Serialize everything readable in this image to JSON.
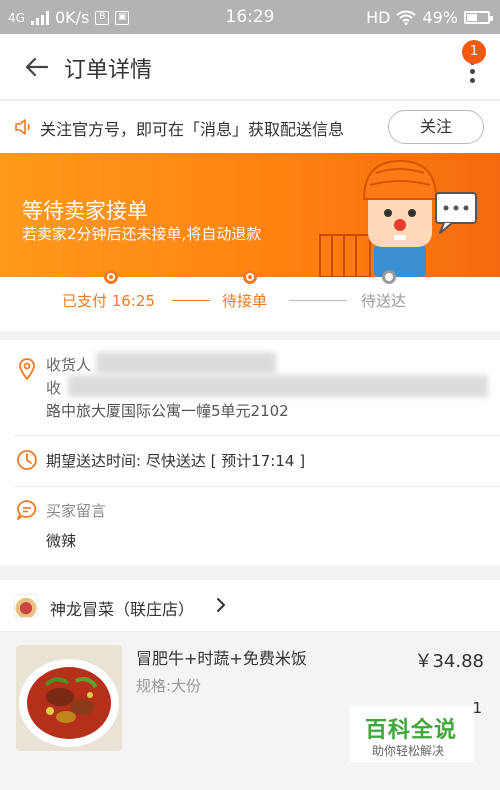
{
  "status_bar": {
    "network": "4G",
    "speed": "0K/s",
    "time": "16:29",
    "hd": "HD",
    "battery": "49%"
  },
  "nav": {
    "title": "订单详情",
    "badge": "1"
  },
  "notice": {
    "text": "关注官方号，即可在「消息」获取配送信息",
    "button": "关注"
  },
  "banner": {
    "headline": "等待卖家接单",
    "subtext": "若卖家2分钟后还未接单,将自动退款"
  },
  "progress": {
    "steps": [
      {
        "label": "已支付 16:25",
        "state": "done"
      },
      {
        "label": "待接单",
        "state": "current"
      },
      {
        "label": "待送达",
        "state": "pending"
      }
    ]
  },
  "address": {
    "line1": "收货人",
    "line2": "收",
    "line3": "路中旅大厦国际公寓一幢5单元2102"
  },
  "expect": {
    "text": "期望送达时间: 尽快送达 [ 预计17:14 ]"
  },
  "buyer_message": {
    "label": "买家留言",
    "value": "微辣"
  },
  "shop": {
    "name": "神龙冒菜（联庄店）"
  },
  "item": {
    "name": "冒肥牛+时蔬+免费米饭",
    "spec": "规格:大份",
    "price": "￥34.88",
    "qty": "1"
  },
  "watermark": {
    "title": "百科全说",
    "subtitle": "助你轻松解决"
  },
  "colors": {
    "accent": "#f47a1f",
    "banner_start": "#ff9a1c",
    "banner_end": "#f56a10",
    "watermark_green": "#3fa63a"
  }
}
